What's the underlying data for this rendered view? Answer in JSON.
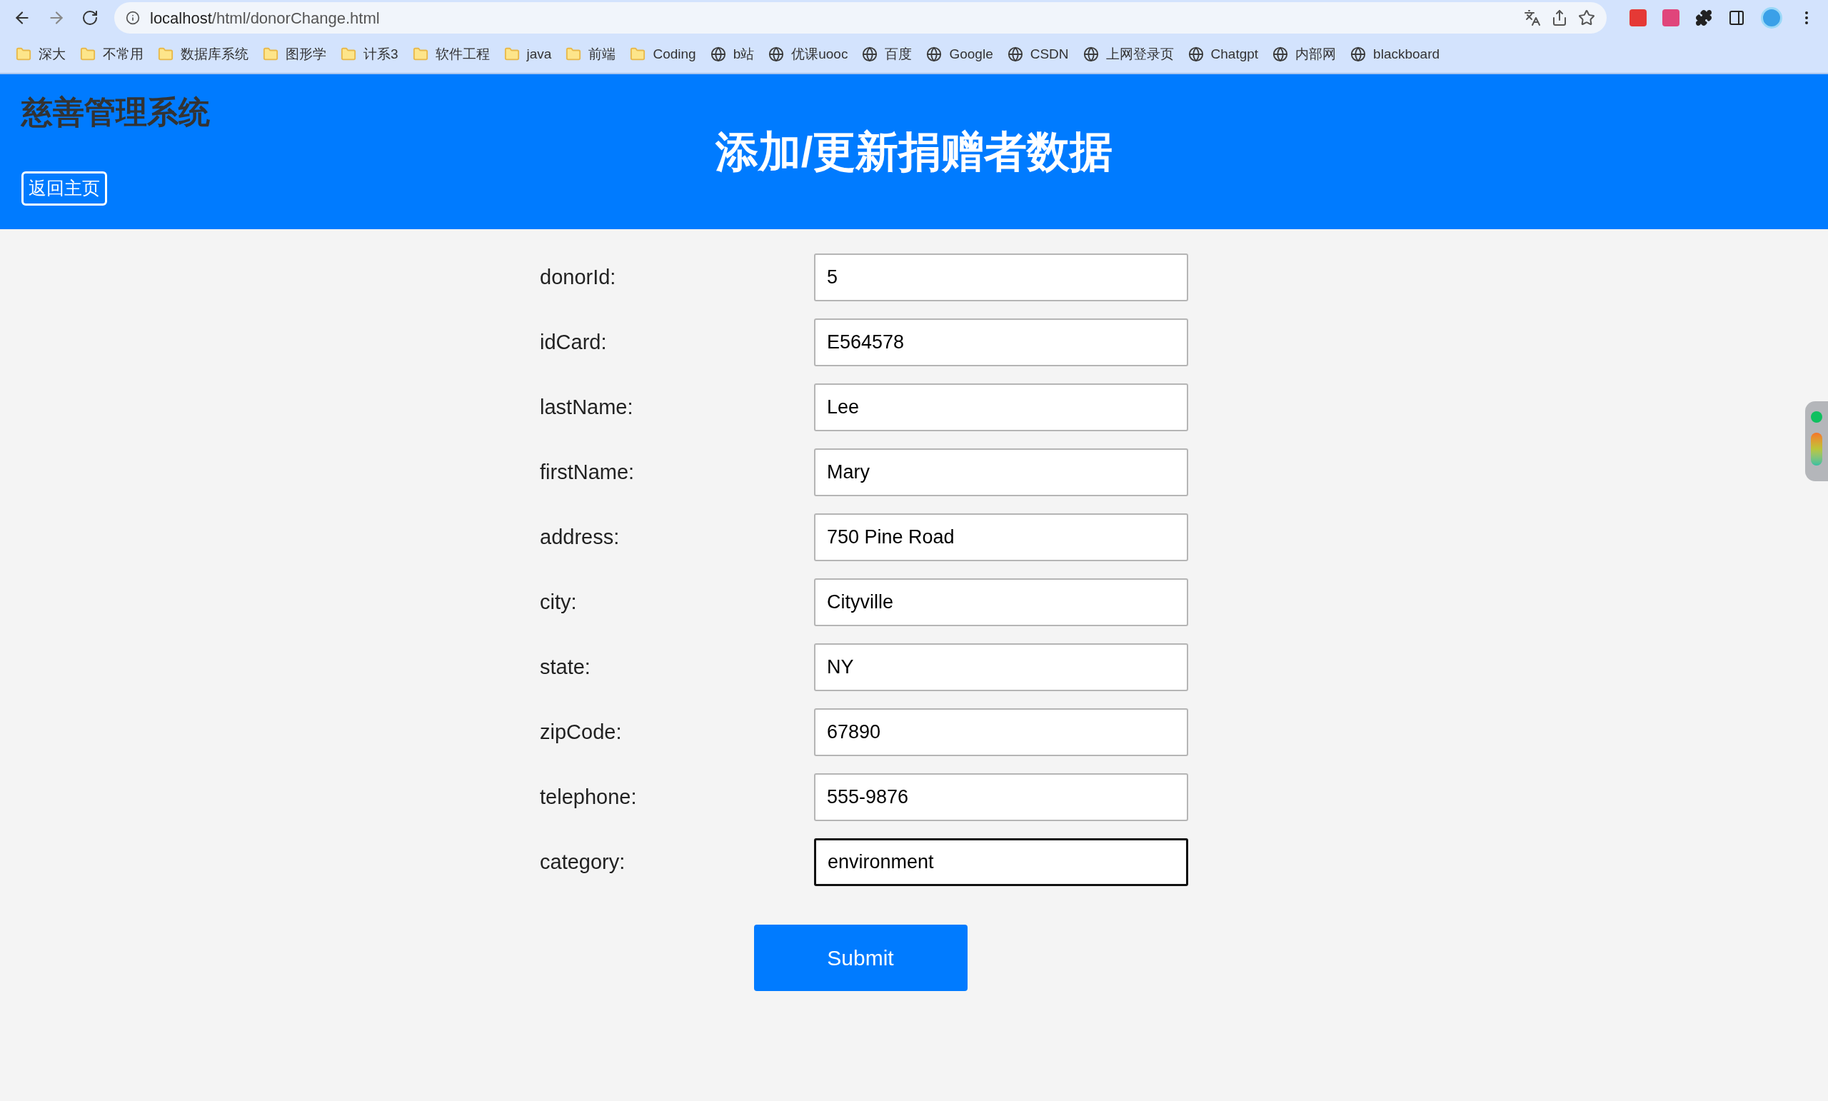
{
  "browser": {
    "url_host": "localhost",
    "url_path": "/html/donorChange.html"
  },
  "bookmarks": [
    {
      "label": "深大",
      "kind": "folder"
    },
    {
      "label": "不常用",
      "kind": "folder"
    },
    {
      "label": "数据库系统",
      "kind": "folder"
    },
    {
      "label": "图形学",
      "kind": "folder"
    },
    {
      "label": "计系3",
      "kind": "folder"
    },
    {
      "label": "软件工程",
      "kind": "folder"
    },
    {
      "label": "java",
      "kind": "folder"
    },
    {
      "label": "前端",
      "kind": "folder"
    },
    {
      "label": "Coding",
      "kind": "folder"
    },
    {
      "label": "b站",
      "kind": "site"
    },
    {
      "label": "优课uooc",
      "kind": "site"
    },
    {
      "label": "百度",
      "kind": "site"
    },
    {
      "label": "Google",
      "kind": "site"
    },
    {
      "label": "CSDN",
      "kind": "site"
    },
    {
      "label": "上网登录页",
      "kind": "site"
    },
    {
      "label": "Chatgpt",
      "kind": "site"
    },
    {
      "label": "内部网",
      "kind": "site"
    },
    {
      "label": "blackboard",
      "kind": "site"
    }
  ],
  "header": {
    "brand": "慈善管理系统",
    "back_button": "返回主页",
    "title": "添加/更新捐赠者数据"
  },
  "form": {
    "fields": [
      {
        "label": "donorId:",
        "value": "5",
        "focused": false
      },
      {
        "label": "idCard:",
        "value": "E564578",
        "focused": false
      },
      {
        "label": "lastName:",
        "value": "Lee",
        "focused": false
      },
      {
        "label": "firstName:",
        "value": "Mary",
        "focused": false
      },
      {
        "label": "address:",
        "value": "750 Pine Road",
        "focused": false
      },
      {
        "label": "city:",
        "value": "Cityville",
        "focused": false
      },
      {
        "label": "state:",
        "value": "NY",
        "focused": false
      },
      {
        "label": "zipCode:",
        "value": "67890",
        "focused": false
      },
      {
        "label": "telephone:",
        "value": "555-9876",
        "focused": false
      },
      {
        "label": "category:",
        "value": "environment",
        "focused": true
      }
    ],
    "submit": "Submit"
  }
}
